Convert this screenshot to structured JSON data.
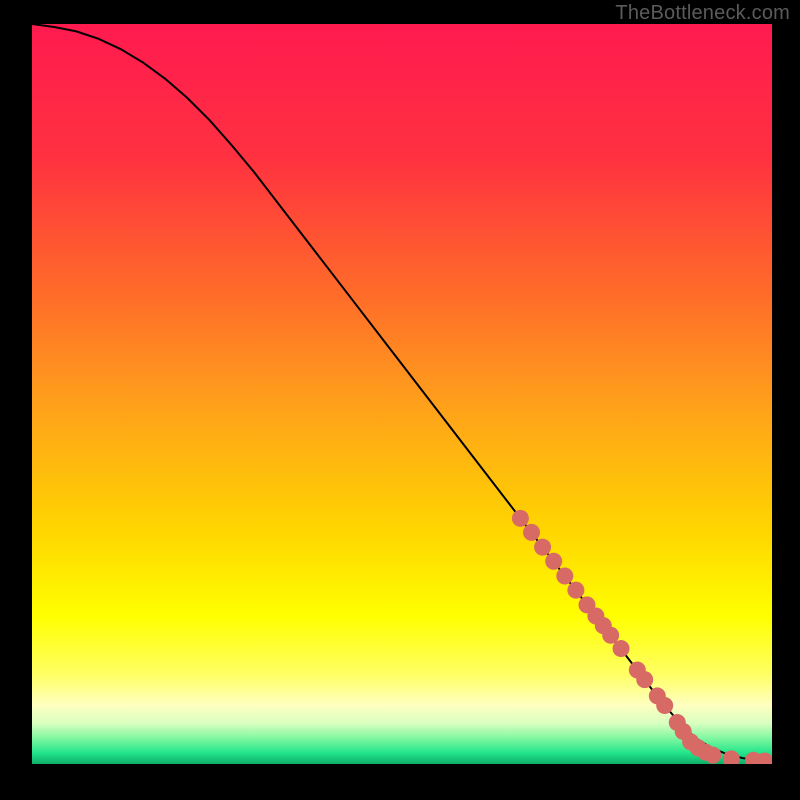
{
  "watermark": "TheBottleneck.com",
  "colors": {
    "background": "#000000",
    "watermark": "#5b5b5b",
    "curve": "#000000",
    "marker_fill": "#d86a66",
    "marker_stroke": "#c7534f",
    "gradient_stops": [
      {
        "offset": 0.0,
        "color": "#ff1a4f"
      },
      {
        "offset": 0.18,
        "color": "#ff3140"
      },
      {
        "offset": 0.36,
        "color": "#ff6a2a"
      },
      {
        "offset": 0.52,
        "color": "#ffa21a"
      },
      {
        "offset": 0.68,
        "color": "#ffd400"
      },
      {
        "offset": 0.8,
        "color": "#ffff00"
      },
      {
        "offset": 0.88,
        "color": "#ffff66"
      },
      {
        "offset": 0.92,
        "color": "#ffffc0"
      },
      {
        "offset": 0.945,
        "color": "#d9ffc0"
      },
      {
        "offset": 0.965,
        "color": "#80f7a0"
      },
      {
        "offset": 0.985,
        "color": "#22e58c"
      },
      {
        "offset": 1.0,
        "color": "#0fae67"
      }
    ]
  },
  "chart_data": {
    "type": "line",
    "title": "",
    "xlabel": "",
    "ylabel": "",
    "xlim": [
      0,
      100
    ],
    "ylim": [
      0,
      100
    ],
    "series": [
      {
        "name": "curve",
        "x": [
          0,
          3,
          6,
          9,
          12,
          15,
          18,
          21,
          24,
          27,
          30,
          35,
          40,
          45,
          50,
          55,
          60,
          65,
          70,
          75,
          80,
          85,
          88,
          90,
          92,
          94,
          96,
          98,
          100
        ],
        "y": [
          100,
          99.6,
          99.0,
          98.0,
          96.6,
          94.8,
          92.6,
          90.0,
          87.0,
          83.6,
          80.0,
          73.5,
          67.0,
          60.5,
          54.0,
          47.5,
          41.0,
          34.5,
          28.0,
          21.5,
          15.0,
          8.5,
          5.0,
          3.3,
          2.1,
          1.3,
          0.8,
          0.5,
          0.4
        ]
      }
    ],
    "markers": {
      "name": "highlighted-points",
      "x": [
        66,
        67.5,
        69,
        70.5,
        72,
        73.5,
        75,
        76.2,
        77.2,
        78.2,
        79.6,
        81.8,
        82.8,
        84.5,
        85.5,
        87.2,
        88.0,
        89.0,
        90.0,
        91.0,
        92.0,
        94.5,
        97.5,
        99.0
      ],
      "y": [
        33.2,
        31.3,
        29.3,
        27.4,
        25.4,
        23.5,
        21.5,
        20.0,
        18.7,
        17.4,
        15.6,
        12.7,
        11.4,
        9.2,
        7.9,
        5.6,
        4.4,
        3.0,
        2.2,
        1.6,
        1.2,
        0.7,
        0.5,
        0.4
      ]
    }
  }
}
